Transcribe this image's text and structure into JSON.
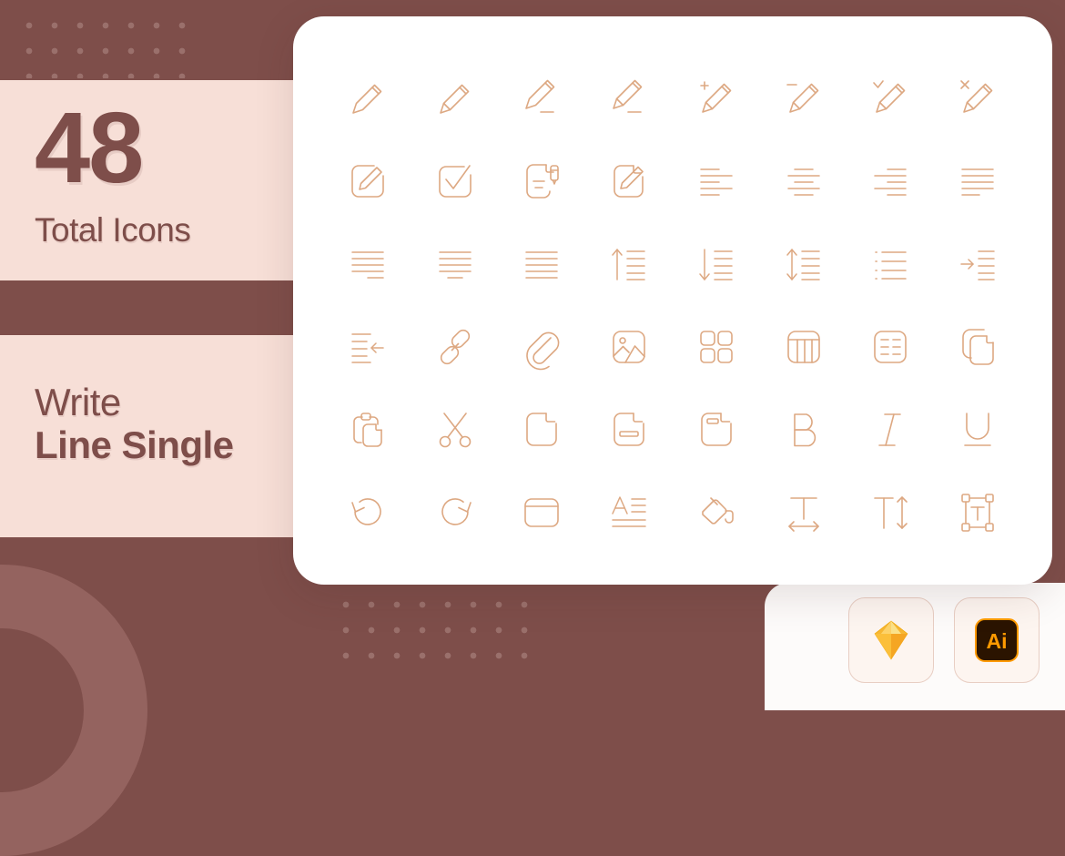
{
  "background": {
    "base_color": "#7e4e4a",
    "panel_color": "#f7dfd7",
    "ring_color": "#94635f",
    "dot_color": "#9a6a66"
  },
  "stats": {
    "count": "48",
    "caption": "Total Icons"
  },
  "title": {
    "category": "Write",
    "style": "Line Single"
  },
  "icon_sheet": {
    "accent_color": "#dda882",
    "columns": 8,
    "rows": 6,
    "icons": [
      {
        "name": "pencil-icon",
        "label": "Pencil"
      },
      {
        "name": "pencil-filled-tip-icon",
        "label": "Pencil Shaded"
      },
      {
        "name": "pencil-underline-icon",
        "label": "Pencil Write"
      },
      {
        "name": "pencil-write-line-icon",
        "label": "Pencil Write Shaded"
      },
      {
        "name": "pencil-add-icon",
        "label": "Pencil Add"
      },
      {
        "name": "pencil-remove-icon",
        "label": "Pencil Remove"
      },
      {
        "name": "pencil-check-icon",
        "label": "Pencil Check"
      },
      {
        "name": "pencil-close-icon",
        "label": "Pencil Close"
      },
      {
        "name": "edit-square-icon",
        "label": "Edit Square"
      },
      {
        "name": "check-square-icon",
        "label": "Check Square"
      },
      {
        "name": "document-pencil-icon",
        "label": "Document Pencil"
      },
      {
        "name": "document-edit-icon",
        "label": "Document Edit"
      },
      {
        "name": "align-left-icon",
        "label": "Align Left"
      },
      {
        "name": "align-center-icon",
        "label": "Align Center"
      },
      {
        "name": "align-right-icon",
        "label": "Align Right"
      },
      {
        "name": "align-justify-icon",
        "label": "Align Justify"
      },
      {
        "name": "text-lines-left-icon",
        "label": "Paragraph Left"
      },
      {
        "name": "text-lines-center-icon",
        "label": "Paragraph Center"
      },
      {
        "name": "text-lines-full-icon",
        "label": "Paragraph Full"
      },
      {
        "name": "sort-ascending-icon",
        "label": "Sort Ascending"
      },
      {
        "name": "sort-descending-icon",
        "label": "Sort Descending"
      },
      {
        "name": "line-spacing-icon",
        "label": "Line Spacing"
      },
      {
        "name": "bullet-list-icon",
        "label": "Bullet List"
      },
      {
        "name": "indent-increase-icon",
        "label": "Indent Increase"
      },
      {
        "name": "indent-decrease-icon",
        "label": "Indent Decrease"
      },
      {
        "name": "link-icon",
        "label": "Link"
      },
      {
        "name": "attachment-icon",
        "label": "Attachment"
      },
      {
        "name": "image-icon",
        "label": "Image"
      },
      {
        "name": "grid-view-icon",
        "label": "Grid View"
      },
      {
        "name": "table-icon",
        "label": "Table"
      },
      {
        "name": "list-view-icon",
        "label": "List View"
      },
      {
        "name": "copy-documents-icon",
        "label": "Copy"
      },
      {
        "name": "paste-icon",
        "label": "Paste"
      },
      {
        "name": "scissors-icon",
        "label": "Cut"
      },
      {
        "name": "file-icon",
        "label": "File"
      },
      {
        "name": "file-field-icon",
        "label": "File Field"
      },
      {
        "name": "file-header-icon",
        "label": "File Header"
      },
      {
        "name": "bold-icon",
        "label": "Bold"
      },
      {
        "name": "italic-icon",
        "label": "Italic"
      },
      {
        "name": "underline-icon",
        "label": "Underline"
      },
      {
        "name": "undo-icon",
        "label": "Undo"
      },
      {
        "name": "redo-icon",
        "label": "Redo"
      },
      {
        "name": "window-card-icon",
        "label": "Window"
      },
      {
        "name": "font-size-icon",
        "label": "Font Size"
      },
      {
        "name": "paint-bucket-icon",
        "label": "Paint Bucket"
      },
      {
        "name": "text-width-icon",
        "label": "Text Width"
      },
      {
        "name": "text-height-icon",
        "label": "Text Height"
      },
      {
        "name": "text-box-icon",
        "label": "Text Box"
      }
    ]
  },
  "formats": {
    "items": [
      {
        "name": "sketch-format-badge",
        "label": "Sketch"
      },
      {
        "name": "illustrator-format-badge",
        "label": "Ai"
      }
    ],
    "illustrator_text": "Ai"
  }
}
